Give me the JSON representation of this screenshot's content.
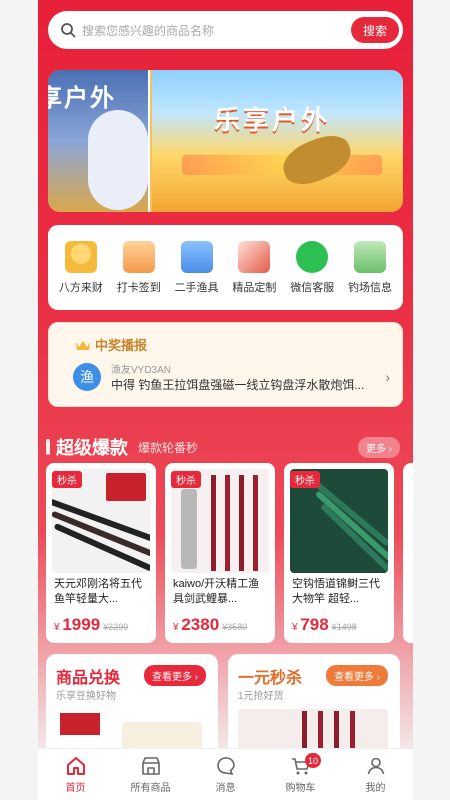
{
  "search": {
    "placeholder": "搜索您感兴趣的商品名称",
    "button": "搜索"
  },
  "banner": {
    "left_text": "享户外",
    "right_text": "乐享户外"
  },
  "nav": [
    {
      "label": "八方来财",
      "icon": "wealth-icon",
      "color": "#f5b93b"
    },
    {
      "label": "打卡签到",
      "icon": "checkin-icon",
      "color": "#f39a4a"
    },
    {
      "label": "二手渔具",
      "icon": "tackle-box-icon",
      "color": "#4a8ee8"
    },
    {
      "label": "精品定制",
      "icon": "custom-rod-icon",
      "color": "#e25a4a"
    },
    {
      "label": "微信客服",
      "icon": "wechat-icon",
      "color": "#2cbf52"
    },
    {
      "label": "钓场信息",
      "icon": "fishing-spot-icon",
      "color": "#6cbf6a"
    }
  ],
  "winners": {
    "title": "中奖播报",
    "avatar_char": "渔",
    "user": "渔友VYD3AN",
    "text": "中得 钓鱼王拉饵盘强磁一线立钩盘浮水散炮饵..."
  },
  "hot": {
    "title": "超级爆款",
    "subtitle": "爆款轮番秒",
    "more": "更多"
  },
  "products": [
    {
      "tag": "秒杀",
      "name": "天元邓刚洺将五代鱼竿轻量大...",
      "currency": "¥",
      "price": "1999",
      "old": "¥3299"
    },
    {
      "tag": "秒杀",
      "name": "kaiwo/开沃精工渔具剑武鲤暴...",
      "currency": "¥",
      "price": "2380",
      "old": "¥3580"
    },
    {
      "tag": "秒杀",
      "name": "空钩悟道锦鲥三代大物竿 超轻...",
      "currency": "¥",
      "price": "798",
      "old": "¥1498"
    }
  ],
  "exchange": {
    "title": "商品兑换",
    "subtitle": "乐享豆换好物",
    "more": "查看更多"
  },
  "flash": {
    "title": "一元秒杀",
    "subtitle": "1元抢好货",
    "more": "查看更多"
  },
  "tabbar": [
    {
      "label": "首页",
      "icon": "home-icon",
      "active": true
    },
    {
      "label": "所有商品",
      "icon": "store-icon",
      "active": false
    },
    {
      "label": "消息",
      "icon": "message-icon",
      "active": false
    },
    {
      "label": "购物车",
      "icon": "cart-icon",
      "active": false,
      "badge": "10"
    },
    {
      "label": "我的",
      "icon": "profile-icon",
      "active": false
    }
  ],
  "colors": {
    "brand": "#e6283b",
    "gold": "#c9862b"
  }
}
